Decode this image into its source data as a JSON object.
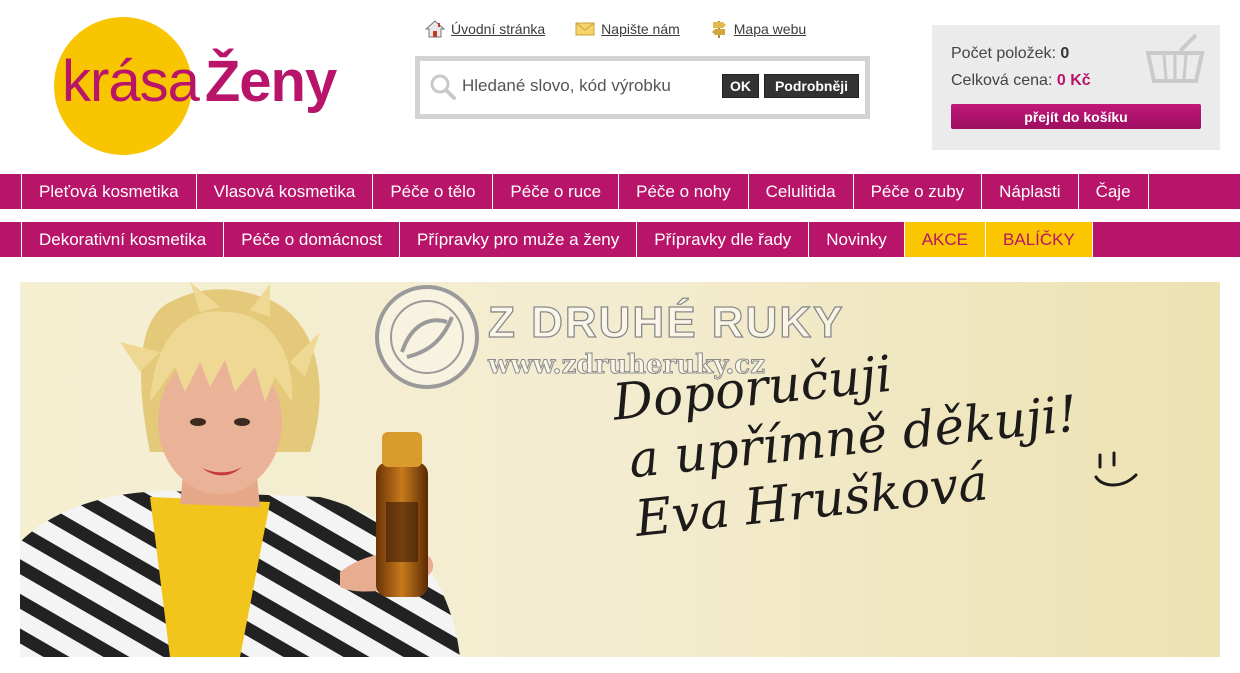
{
  "logo": {
    "word1": "krása",
    "word2": "Ženy"
  },
  "top_links": [
    {
      "label": "Úvodní stránka",
      "icon": "home-icon"
    },
    {
      "label": "Napište nám",
      "icon": "envelope-icon"
    },
    {
      "label": "Mapa webu",
      "icon": "signpost-icon"
    }
  ],
  "search": {
    "placeholder": "Hledané slovo, kód výrobku",
    "ok_label": "OK",
    "advanced_label": "Podrobněji"
  },
  "cart": {
    "items_label": "Počet položek:",
    "items_value": "0",
    "total_label": "Celková cena:",
    "total_value": "0 Kč",
    "button_label": "přejít do košíku"
  },
  "menu1": [
    {
      "label": "Pleťová kosmetika"
    },
    {
      "label": "Vlasová kosmetika"
    },
    {
      "label": "Péče o tělo"
    },
    {
      "label": "Péče o ruce"
    },
    {
      "label": "Péče o nohy"
    },
    {
      "label": "Celulitida"
    },
    {
      "label": "Péče o zuby"
    },
    {
      "label": "Náplasti"
    },
    {
      "label": "Čaje"
    }
  ],
  "menu2": [
    {
      "label": "Dekorativní kosmetika"
    },
    {
      "label": "Péče o domácnost"
    },
    {
      "label": "Přípravky pro muže a ženy"
    },
    {
      "label": "Přípravky dle řady"
    },
    {
      "label": "Novinky"
    },
    {
      "label": "AKCE",
      "highlight": true
    },
    {
      "label": "BALÍČKY",
      "highlight": true
    }
  ],
  "banner": {
    "watermark_title": "Z DRUHÉ RUKY",
    "watermark_url": "www.zdruheruky.cz",
    "handwriting_line1": "Doporučuji",
    "handwriting_line2": "a upřímně děkuji!",
    "signature": "Eva Hrušková"
  },
  "colors": {
    "brand": "#b8156a",
    "accent": "#fbc600",
    "logo_circle": "#f9c400",
    "button_dark": "#333333",
    "cart_bg": "#ebebeb"
  }
}
